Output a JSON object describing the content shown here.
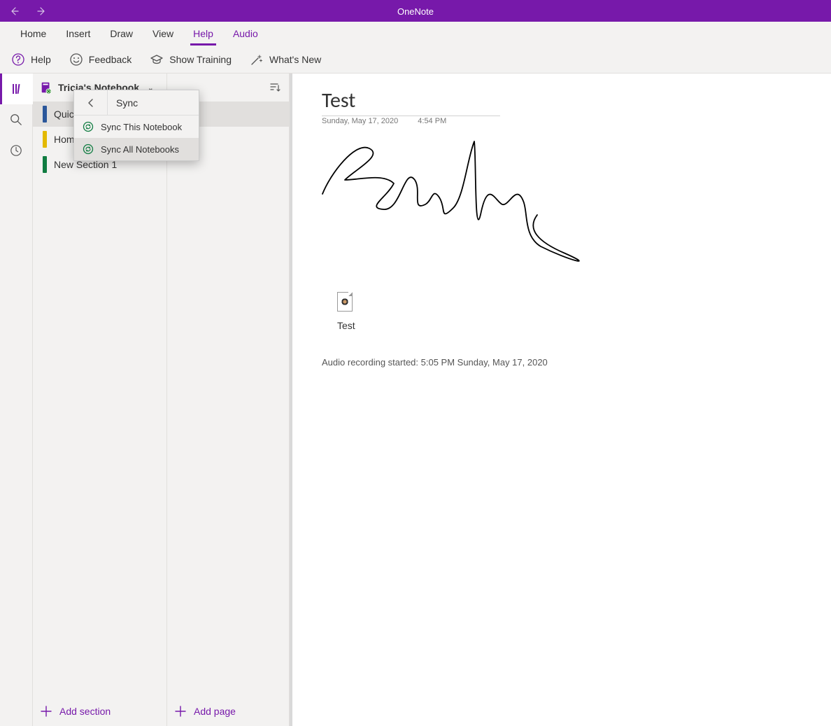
{
  "app": {
    "title": "OneNote"
  },
  "tabs": {
    "items": [
      "Home",
      "Insert",
      "Draw",
      "View",
      "Help",
      "Audio"
    ],
    "active": "Help"
  },
  "ribbon": {
    "help": "Help",
    "feedback": "Feedback",
    "show_training": "Show Training",
    "whats_new": "What's New"
  },
  "notebook": {
    "name": "Tricia's Notebook",
    "sections": [
      {
        "label": "Quick Notes",
        "color": "#2b579a"
      },
      {
        "label": "Homework",
        "color": "#e3b900"
      },
      {
        "label": "New Section 1",
        "color": "#107c41"
      }
    ],
    "add_section": "Add section"
  },
  "pages": {
    "items": [
      ""
    ],
    "add_page": "Add page"
  },
  "sync_menu": {
    "title": "Sync",
    "sync_this": "Sync This Notebook",
    "sync_all": "Sync All Notebooks"
  },
  "page": {
    "title": "Test",
    "date": "Sunday, May 17, 2020",
    "time": "4:54 PM",
    "audio_label": "Test",
    "audio_started": "Audio recording started: 5:05 PM Sunday, May 17, 2020"
  },
  "colors": {
    "brand": "#7719AA"
  }
}
